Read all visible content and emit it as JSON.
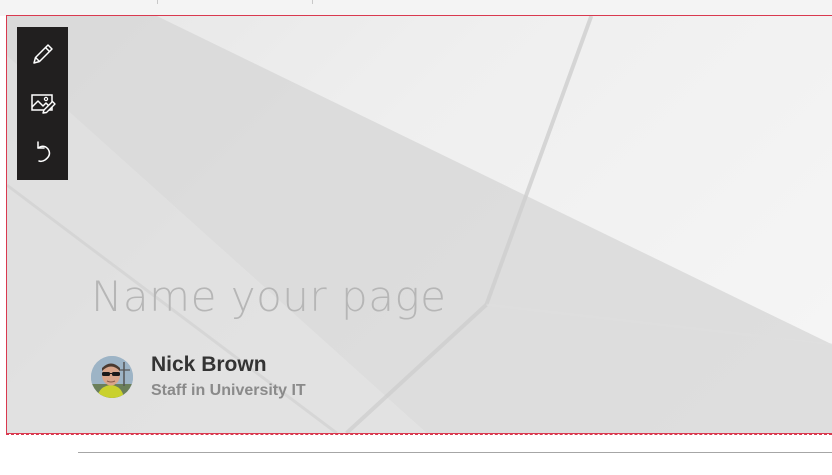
{
  "header": {
    "title_placeholder": "Name your page"
  },
  "author": {
    "name": "Nick Brown",
    "role": "Staff in University IT"
  },
  "toolbar": {
    "items": [
      {
        "icon": "pencil-icon",
        "action": "edit"
      },
      {
        "icon": "image-edit-icon",
        "action": "change-image"
      },
      {
        "icon": "undo-icon",
        "action": "reset"
      }
    ]
  },
  "colors": {
    "selection_border": "#d9394f",
    "toolbar_bg": "#211f1f",
    "placeholder_text": "#b6b6b6"
  }
}
